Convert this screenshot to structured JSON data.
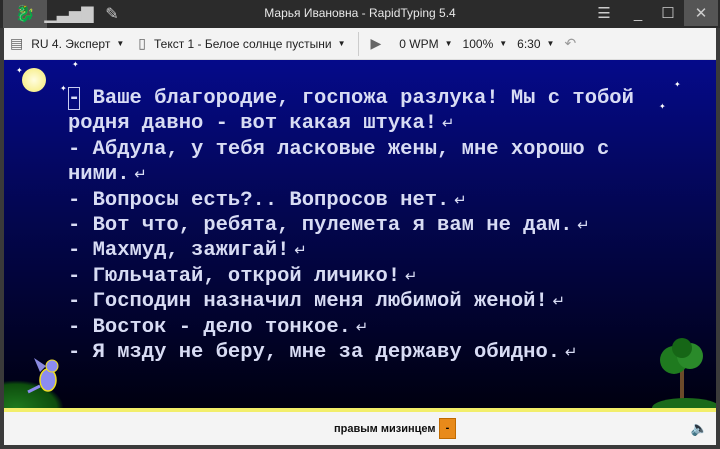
{
  "window": {
    "title": "Марья Ивановна - RapidTyping 5.4"
  },
  "toolbar": {
    "course": "RU 4. Эксперт",
    "lesson": "Текст 1 - Белое солнце пустыни",
    "speed": "0 WPM",
    "zoom": "100%",
    "time": "6:30"
  },
  "lines": [
    "- Ваше благородие, госпожа разлука! Мы с тобой",
    "родня давно - вот какая штука!",
    "- Абдула, у тебя ласковые жены, мне хорошо с",
    "ними.",
    "- Вопросы есть?.. Вопросов нет.",
    "- Вот что, ребята, пулемета я вам не дам.",
    "- Махмуд, зажигай!",
    "- Гюльчатай, открой личико!",
    "- Господин назначил меня любимой женой!",
    "- Восток - дело тонкое.",
    "- Я мзду не беру, мне за державу обидно."
  ],
  "line_returns": [
    false,
    true,
    false,
    true,
    true,
    true,
    true,
    true,
    true,
    true,
    true
  ],
  "status": {
    "hint": "правым мизинцем",
    "key": "-"
  }
}
